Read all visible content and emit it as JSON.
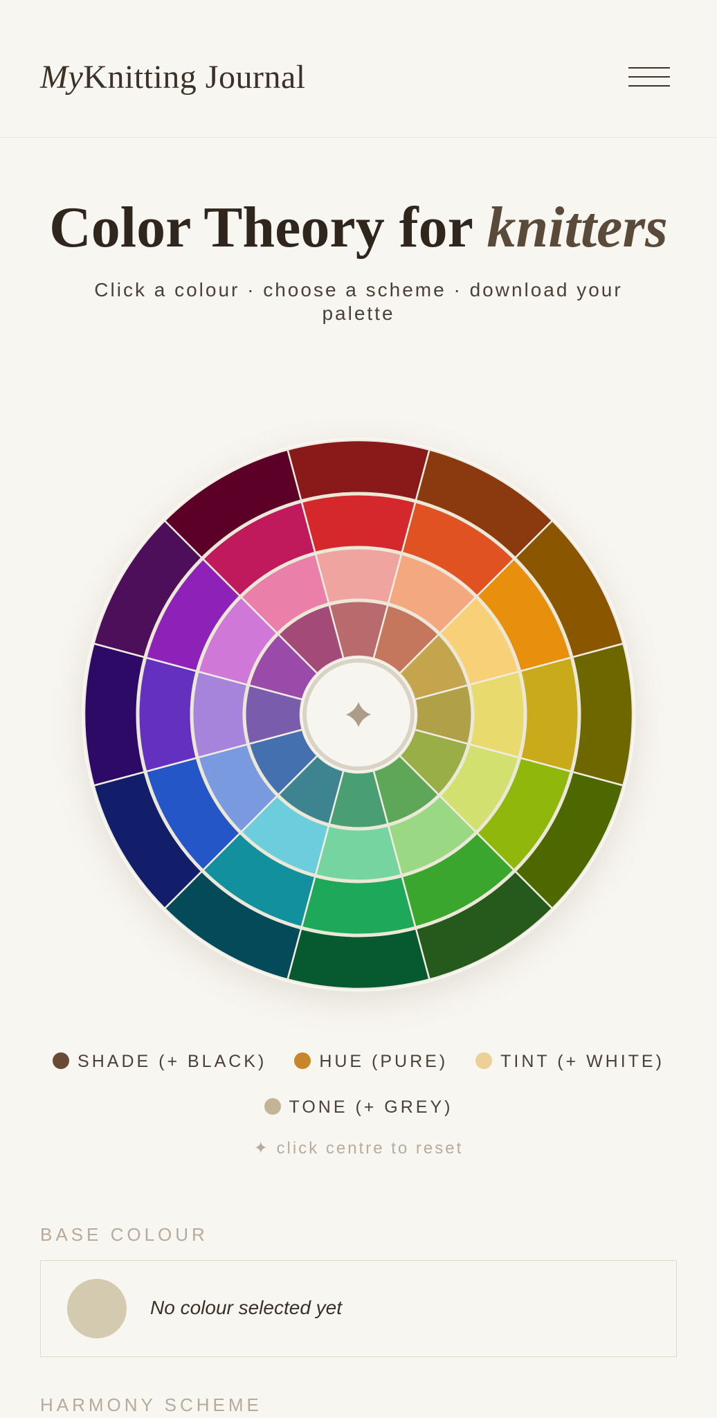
{
  "header": {
    "brand_my": "My",
    "brand_rest": "Knitting Journal"
  },
  "hero": {
    "title_main": "Color Theory for ",
    "title_emphasis": "knitters",
    "subtitle": "Click a colour · choose a scheme · download your palette"
  },
  "wheel": {
    "rings": [
      {
        "name": "shade",
        "colors": [
          "#8a1a1a",
          "#8a3a0e",
          "#8a5600",
          "#6e6700",
          "#4e6800",
          "#255a1c",
          "#075a30",
          "#044a58",
          "#121e6a",
          "#2c0a66",
          "#4d0e5a",
          "#5c0028"
        ]
      },
      {
        "name": "hue",
        "colors": [
          "#d4282c",
          "#e05222",
          "#e8900e",
          "#c8aa1a",
          "#90b80c",
          "#3aa62e",
          "#1ea85a",
          "#12909e",
          "#2456c8",
          "#6430c0",
          "#8e22b8",
          "#c01a5c"
        ]
      },
      {
        "name": "tint",
        "colors": [
          "#f0a4a0",
          "#f4a880",
          "#f8d078",
          "#e8da6c",
          "#d2e070",
          "#9ad884",
          "#76d4a0",
          "#6ccedc",
          "#7a9ae0",
          "#a684dc",
          "#d078d8",
          "#ea80aa"
        ]
      },
      {
        "name": "tone",
        "colors": [
          "#b86a6c",
          "#c4775c",
          "#c4a44c",
          "#b0a048",
          "#9aae48",
          "#5ea658",
          "#4a9e74",
          "#3e8490",
          "#4470b0",
          "#7a5cac",
          "#9a4aa8",
          "#a44a78"
        ]
      }
    ]
  },
  "legend": [
    {
      "label": "SHADE (+ BLACK)",
      "color": "#6a4a36"
    },
    {
      "label": "HUE (PURE)",
      "color": "#c8862a"
    },
    {
      "label": "TINT (+ WHITE)",
      "color": "#ecd096"
    },
    {
      "label": "TONE (+ GREY)",
      "color": "#c2b494"
    }
  ],
  "reset_hint": "✦ click centre to reset",
  "base_colour": {
    "label": "BASE COLOUR",
    "empty_text": "No colour selected yet",
    "swatch_color": "#d4cab0"
  },
  "harmony": {
    "label": "HARMONY SCHEME"
  }
}
